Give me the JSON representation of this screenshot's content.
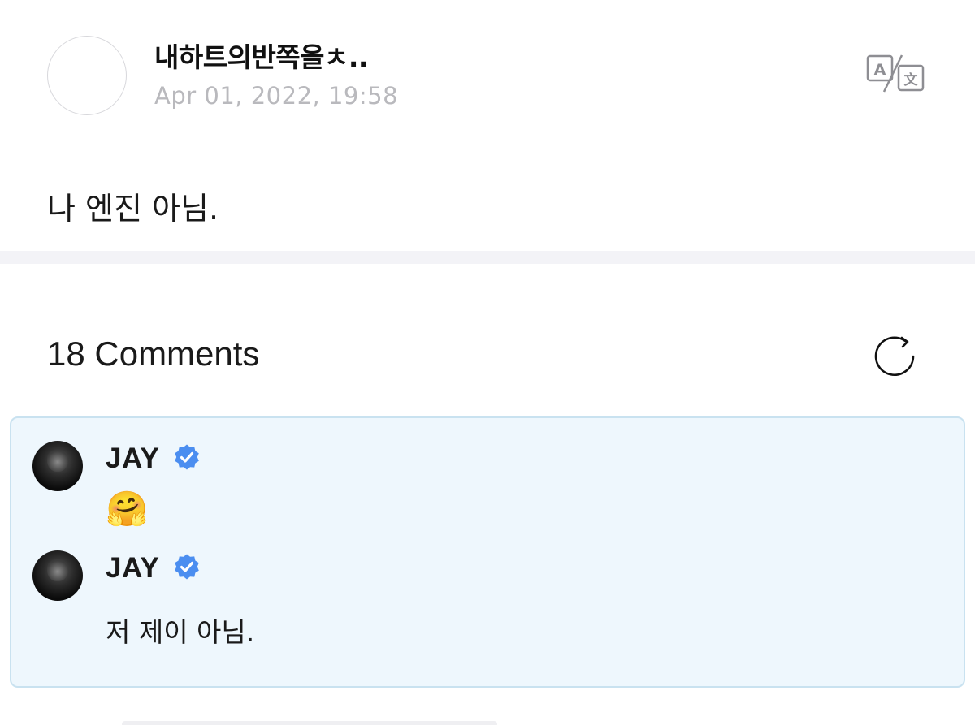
{
  "post": {
    "author": "내하트의반쪽을ㅊ..",
    "timestamp": "Apr 01, 2022, 19:58",
    "body": "나 엔진 아님.",
    "translate_icon": "translate-icon"
  },
  "comments": {
    "count_label": "18 Comments",
    "refresh_icon": "refresh-icon",
    "items": [
      {
        "author": "JAY",
        "verified": true,
        "text": "🤗"
      },
      {
        "author": "JAY",
        "verified": true,
        "text": "저 제이 아님."
      }
    ]
  },
  "colors": {
    "verified_blue": "#4b8ef0",
    "highlight_bg": "#eef7fd",
    "highlight_border": "#c9e2f0",
    "timestamp_gray": "#b9b9bd"
  }
}
